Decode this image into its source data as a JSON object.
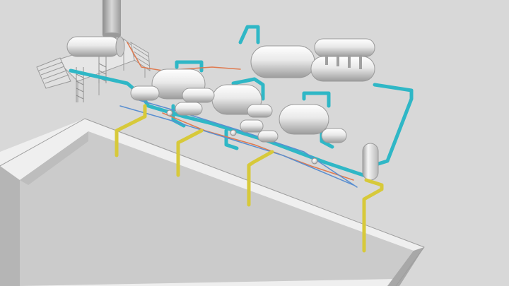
{
  "scene": {
    "colors": {
      "background": "#dcdcdc",
      "floor": "#d6d6d6",
      "basin_rim": "#f0f0f0",
      "basin_floor": "#cfcfcf",
      "basin_wall_inner": "#b9b9b9",
      "vessel_light": "#f5f5f5",
      "vessel_mid": "#d2d2d2",
      "vessel_dark": "#9a9a9a",
      "pipe_cyan": "#2fb7c6",
      "pipe_cyan_dark": "#1d8d99",
      "pipe_yellow": "#d7c93a",
      "pipe_yellow_dark": "#a99c22",
      "pipe_orange": "#e07a4f",
      "steel": "#a8a8a8"
    },
    "equipment_icons": [
      "boiler-icon",
      "stack-icon",
      "vessel-icon",
      "column-icon",
      "heat-exchanger-icon",
      "pump-icon",
      "staircase-icon"
    ]
  }
}
